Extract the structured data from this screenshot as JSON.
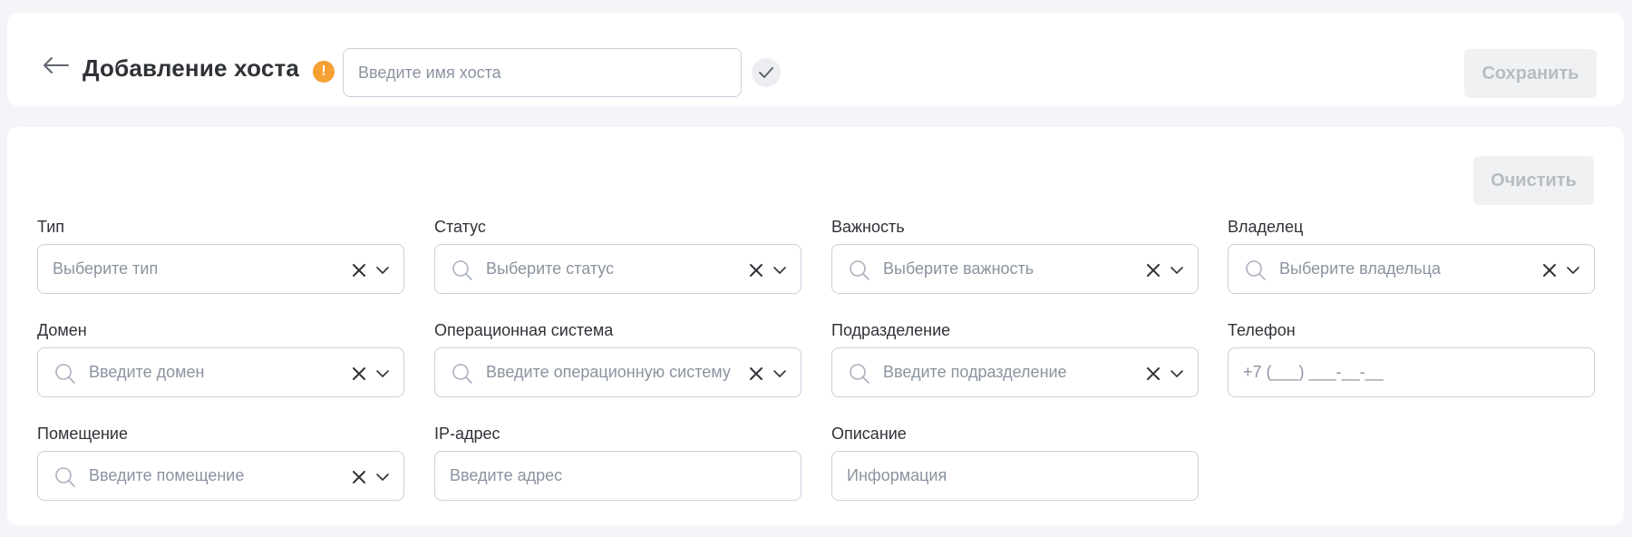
{
  "header": {
    "title": "Добавление хоста",
    "warning_icon": "!",
    "host_input_placeholder": "Введите имя хоста",
    "save_label": "Сохранить"
  },
  "form": {
    "clear_label": "Очистить",
    "fields": {
      "type": {
        "label": "Тип",
        "placeholder": "Выберите тип"
      },
      "status": {
        "label": "Статус",
        "placeholder": "Выберите статус"
      },
      "importance": {
        "label": "Важность",
        "placeholder": "Выберите важность"
      },
      "owner": {
        "label": "Владелец",
        "placeholder": "Выберите владельца"
      },
      "domain": {
        "label": "Домен",
        "placeholder": "Введите домен"
      },
      "os": {
        "label": "Операционная система",
        "placeholder": "Введите операционную систему"
      },
      "division": {
        "label": "Подразделение",
        "placeholder": "Введите подразделение"
      },
      "phone": {
        "label": "Телефон",
        "placeholder": "+7 (___) ___-__-__"
      },
      "room": {
        "label": "Помещение",
        "placeholder": "Введите помещение"
      },
      "ip": {
        "label": "IP-адрес",
        "placeholder": "Введите адрес"
      },
      "description": {
        "label": "Описание",
        "placeholder": "Информация"
      }
    }
  },
  "colors": {
    "background": "#f4f5f8",
    "warning": "#f6a033",
    "border": "#c8d0dc",
    "placeholder": "#8a93a0",
    "disabled_button_bg": "#f0f1f3",
    "disabled_button_text": "#b7bcc3"
  },
  "icons": {
    "back": "arrow-left-icon",
    "warning": "warning-icon",
    "confirm": "check-icon",
    "search": "search-icon",
    "clear": "close-icon",
    "dropdown": "chevron-down-icon"
  }
}
